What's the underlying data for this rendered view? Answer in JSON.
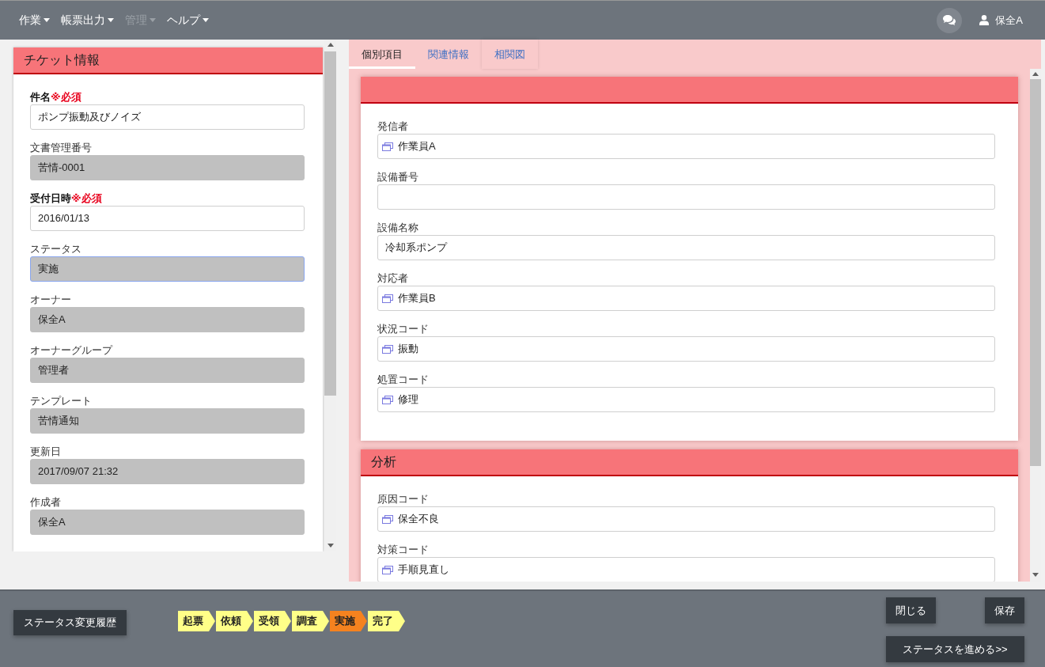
{
  "nav": {
    "menus": [
      {
        "label": "作業",
        "disabled": false
      },
      {
        "label": "帳票出力",
        "disabled": false
      },
      {
        "label": "管理",
        "disabled": true
      },
      {
        "label": "ヘルプ",
        "disabled": false
      }
    ],
    "user": {
      "name": "保全A"
    }
  },
  "ticket_panel": {
    "title": "チケット情報",
    "fields": [
      {
        "label": "件名",
        "required": true,
        "required_note": "※必須",
        "value": "ポンプ振動及びノイズ",
        "readonly": false,
        "focused": false
      },
      {
        "label": "文書管理番号",
        "required": false,
        "value": "苦情-0001",
        "readonly": true,
        "focused": false
      },
      {
        "label": "受付日時",
        "required": true,
        "required_note": "※必須",
        "value": "2016/01/13",
        "readonly": false,
        "focused": false
      },
      {
        "label": "ステータス",
        "required": false,
        "value": "実施",
        "readonly": true,
        "focused": true
      },
      {
        "label": "オーナー",
        "required": false,
        "value": "保全A",
        "readonly": true,
        "focused": false
      },
      {
        "label": "オーナーグループ",
        "required": false,
        "value": "管理者",
        "readonly": true,
        "focused": false
      },
      {
        "label": "テンプレート",
        "required": false,
        "value": "苦情通知",
        "readonly": true,
        "focused": false
      },
      {
        "label": "更新日",
        "required": false,
        "value": "2017/09/07 21:32",
        "readonly": true,
        "focused": false
      },
      {
        "label": "作成者",
        "required": false,
        "value": "保全A",
        "readonly": true,
        "focused": false
      }
    ]
  },
  "tabs": [
    {
      "label": "個別項目",
      "selected": true,
      "hovered": false
    },
    {
      "label": "関連情報",
      "selected": false,
      "hovered": false
    },
    {
      "label": "相関図",
      "selected": false,
      "hovered": true
    }
  ],
  "sections": [
    {
      "fields": [
        {
          "label": "発信者",
          "value": "作業員A",
          "lookup": true
        },
        {
          "label": "設備番号",
          "lookup": false
        },
        {
          "label": "設備名称",
          "value": "冷却系ポンプ",
          "lookup": false
        },
        {
          "label": "対応者",
          "value": "作業員B",
          "lookup": true
        },
        {
          "label": "状況コード",
          "value": "振動",
          "lookup": true
        },
        {
          "label": "処置コード",
          "value": "修理",
          "lookup": true
        }
      ]
    },
    {
      "title": "分析",
      "fields": [
        {
          "label": "原因コード",
          "value": "保全不良",
          "lookup": true
        },
        {
          "label": "対策コード",
          "value": "手順見直し",
          "lookup": true
        }
      ]
    }
  ],
  "status_history_button": "ステータス変更履歴",
  "workflow": [
    {
      "label": "起票",
      "current": false
    },
    {
      "label": "依頼",
      "current": false
    },
    {
      "label": "受領",
      "current": false
    },
    {
      "label": "調査",
      "current": false
    },
    {
      "label": "実施",
      "current": true
    },
    {
      "label": "完了",
      "current": false
    }
  ],
  "footer_buttons": {
    "close": "閉じる",
    "save": "保存",
    "advance": "ステータスを進める>>"
  }
}
